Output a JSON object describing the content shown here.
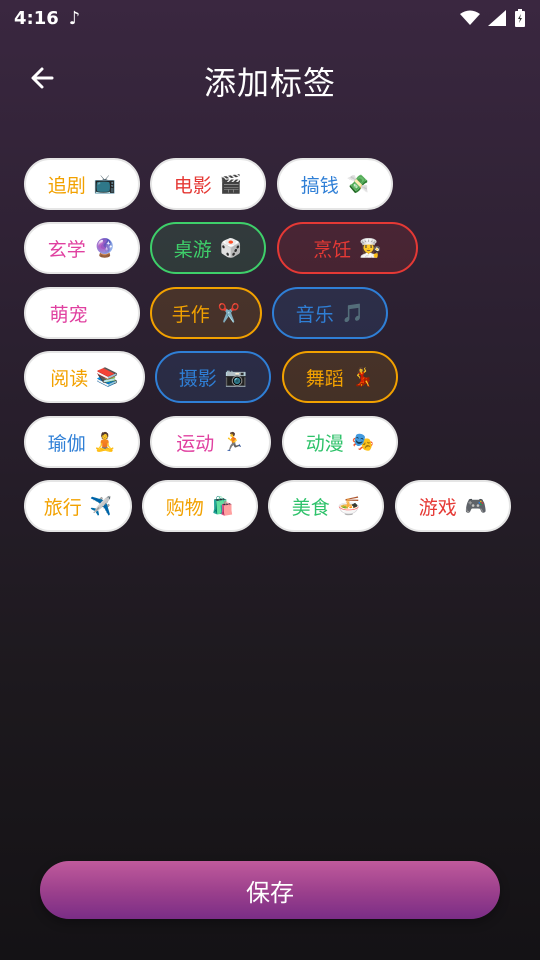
{
  "status": {
    "time": "4:16"
  },
  "header": {
    "title": "添加标签"
  },
  "tags": [
    {
      "label": "追剧",
      "emoji": "📺",
      "color": "#f2a100",
      "selected": false
    },
    {
      "label": "电影",
      "emoji": "🎬",
      "color": "#e53935",
      "selected": false
    },
    {
      "label": "搞钱",
      "emoji": "💸",
      "color": "#2f7fd6",
      "selected": false
    },
    {
      "label": "玄学",
      "emoji": "🔮",
      "color": "#e040a0",
      "selected": false
    },
    {
      "label": "桌游",
      "emoji": "🎲",
      "color": "#3ecf6a",
      "selected": true
    },
    {
      "label": "烹饪",
      "emoji": "👩‍🍳",
      "color": "#e53935",
      "selected": true
    },
    {
      "label": "萌宠",
      "emoji": "🐱",
      "color": "#e040a0",
      "selected": false
    },
    {
      "label": "手作",
      "emoji": "✂️",
      "color": "#f2a100",
      "selected": true
    },
    {
      "label": "音乐",
      "emoji": "🎵",
      "color": "#2f7fd6",
      "selected": true
    },
    {
      "label": "阅读",
      "emoji": "📚",
      "color": "#f2a100",
      "selected": false
    },
    {
      "label": "摄影",
      "emoji": "📷",
      "color": "#2f7fd6",
      "selected": true
    },
    {
      "label": "舞蹈",
      "emoji": "💃",
      "color": "#f2a100",
      "selected": true
    },
    {
      "label": "瑜伽",
      "emoji": "🧘",
      "color": "#2f7fd6",
      "selected": false
    },
    {
      "label": "运动",
      "emoji": "🏃",
      "color": "#e040a0",
      "selected": false
    },
    {
      "label": "动漫",
      "emoji": "🎭",
      "color": "#2ec26a",
      "selected": false
    },
    {
      "label": "旅行",
      "emoji": "✈️",
      "color": "#f2a100",
      "selected": false
    },
    {
      "label": "购物",
      "emoji": "🛍️",
      "color": "#f2a100",
      "selected": false
    },
    {
      "label": "美食",
      "emoji": "🍜",
      "color": "#2ec26a",
      "selected": false
    },
    {
      "label": "游戏",
      "emoji": "🎮",
      "color": "#e53935",
      "selected": false
    }
  ],
  "save": {
    "label": "保存"
  }
}
